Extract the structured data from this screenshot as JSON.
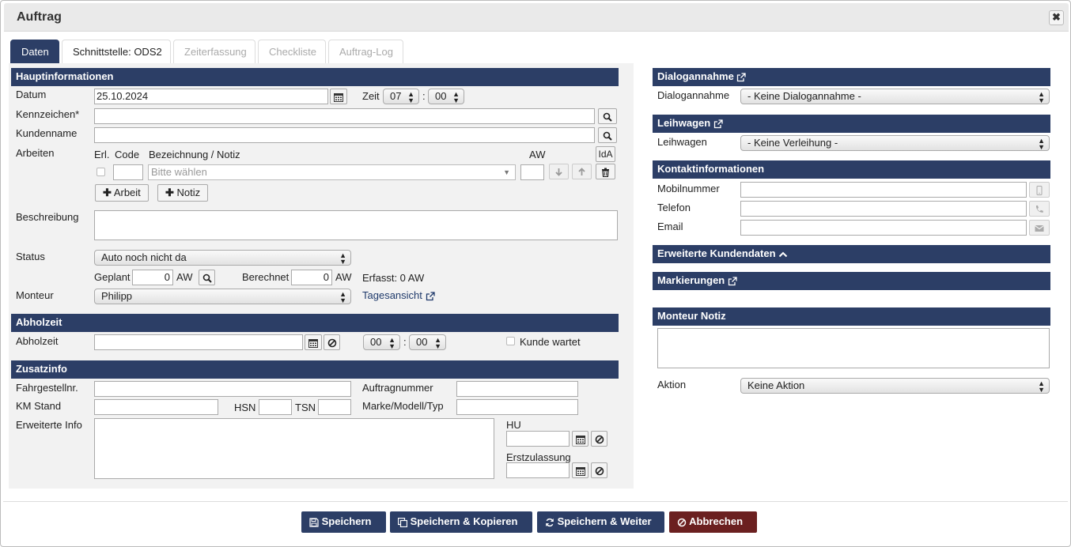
{
  "window": {
    "title": "Auftrag",
    "close_glyph": "✖"
  },
  "tabs": [
    {
      "label": "Daten",
      "state": "active"
    },
    {
      "label": "Schnittstelle: ODS2",
      "state": "normal"
    },
    {
      "label": "Zeiterfassung",
      "state": "disabled"
    },
    {
      "label": "Checkliste",
      "state": "disabled"
    },
    {
      "label": "Auftrag-Log",
      "state": "disabled"
    }
  ],
  "haupt": {
    "title": "Hauptinformationen",
    "datum_label": "Datum",
    "datum_value": "25.10.2024",
    "zeit_label": "Zeit",
    "zeit_hour": "07",
    "zeit_min": "00",
    "colon": ":",
    "kennzeichen_label": "Kennzeichen*",
    "kennzeichen_value": "",
    "kundenname_label": "Kundenname",
    "kundenname_value": "",
    "arbeiten_label": "Arbeiten",
    "col_erl": "Erl.",
    "col_code": "Code",
    "col_bez": "Bezeichnung / Notiz",
    "col_aw": "AW",
    "ida_label": "IdA",
    "bez_placeholder": "Bitte wählen",
    "add_arbeit": "Arbeit",
    "add_notiz": "Notiz",
    "beschreibung_label": "Beschreibung",
    "status_label": "Status",
    "status_value": "Auto noch nicht da",
    "geplant_label": "Geplant",
    "geplant_value": "0",
    "aw_unit": "AW",
    "berechnet_label": "Berechnet",
    "berechnet_value": "0",
    "erfasst_text": "Erfasst: 0 AW",
    "monteur_label": "Monteur",
    "monteur_value": "Philipp",
    "tagesansicht_link": "Tagesansicht"
  },
  "abholzeit": {
    "title": "Abholzeit",
    "label": "Abholzeit",
    "value": "",
    "hour": "00",
    "min": "00",
    "kunde_wartet": "Kunde wartet"
  },
  "zusatz": {
    "title": "Zusatzinfo",
    "fahrgestell_label": "Fahrgestellnr.",
    "auftragnummer_label": "Auftragnummer",
    "km_label": "KM Stand",
    "hsn_label": "HSN",
    "tsn_label": "TSN",
    "marke_label": "Marke/Modell/Typ",
    "erweitert_label": "Erweiterte Info",
    "hu_label": "HU",
    "erstzulassung_label": "Erstzulassung"
  },
  "right": {
    "dialog_title": "Dialogannahme",
    "dialog_label": "Dialogannahme",
    "dialog_value": "- Keine Dialogannahme -",
    "leih_title": "Leihwagen",
    "leih_label": "Leihwagen",
    "leih_value": "- Keine Verleihung -",
    "kontakt_title": "Kontaktinformationen",
    "mobil_label": "Mobilnummer",
    "telefon_label": "Telefon",
    "email_label": "Email",
    "erweitert_title": "Erweiterte Kundendaten",
    "markierungen_title": "Markierungen",
    "monteur_notiz_title": "Monteur Notiz",
    "aktion_label": "Aktion",
    "aktion_value": "Keine Aktion"
  },
  "footer": {
    "save": "Speichern",
    "save_copy": "Speichern & Kopieren",
    "save_next": "Speichern & Weiter",
    "cancel": "Abbrechen"
  },
  "colors": {
    "primary": "#2c3e66",
    "danger": "#6b2020",
    "panel": "#f2f2f2"
  },
  "icons": [
    "calendar-icon",
    "search-icon",
    "ban-icon",
    "trash-icon",
    "arrow-down-icon",
    "arrow-up-icon",
    "plus-icon",
    "external-link-icon",
    "mobile-icon",
    "phone-icon",
    "envelope-icon",
    "chevron-up-icon",
    "save-icon",
    "copy-icon",
    "refresh-icon",
    "close-icon"
  ]
}
